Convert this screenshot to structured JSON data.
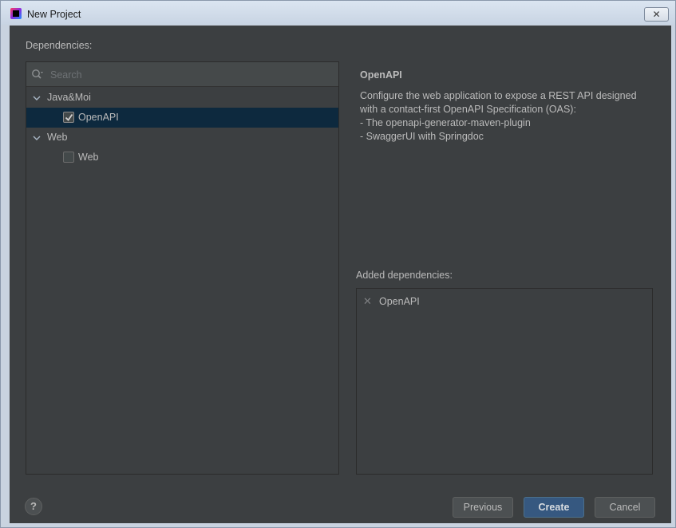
{
  "window": {
    "title": "New Project",
    "close_glyph": "✕"
  },
  "dependencies_label": "Dependencies:",
  "search": {
    "placeholder": "Search",
    "value": ""
  },
  "tree": {
    "groups": [
      {
        "label": "Java&Moi",
        "expanded": true,
        "items": [
          {
            "label": "OpenAPI",
            "checked": true,
            "selected": true
          }
        ]
      },
      {
        "label": "Web",
        "expanded": true,
        "items": [
          {
            "label": "Web",
            "checked": false,
            "selected": false
          }
        ]
      }
    ]
  },
  "info": {
    "title": "OpenAPI",
    "description": "Configure the web application to expose a REST API designed\nwith a contact-first OpenAPI Specification (OAS):\n - The openapi-generator-maven-plugin\n - SwaggerUI with Springdoc"
  },
  "added_dependencies": {
    "label": "Added dependencies:",
    "items": [
      {
        "name": "OpenAPI",
        "remove_icon": "close-icon"
      }
    ]
  },
  "footer": {
    "help_label": "?",
    "previous_label": "Previous",
    "create_label": "Create",
    "cancel_label": "Cancel"
  },
  "colors": {
    "background": "#3c3f41",
    "selection": "#0d293e",
    "default_button": "#365880",
    "text": "#bbbbbb"
  }
}
